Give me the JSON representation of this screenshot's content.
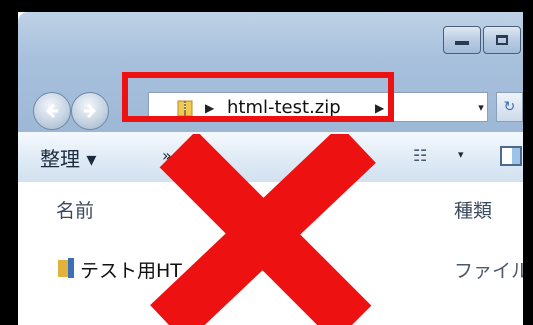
{
  "window": {
    "minimize_icon": "minimize-icon",
    "maximize_icon": "maximize-icon"
  },
  "navigation": {
    "back_icon": "back-arrow-icon",
    "forward_icon": "forward-arrow-icon",
    "address": {
      "path_label": "html-test.zip",
      "icon": "zip-folder-icon",
      "refresh_icon": "refresh-icon"
    }
  },
  "toolbar": {
    "organize_label": "整理 ▾",
    "more_label": "»",
    "view_icon": "view-list-icon",
    "preview_pane_icon": "preview-pane-icon"
  },
  "columns": {
    "name": "名前",
    "type": "種類"
  },
  "files": [
    {
      "name": "テスト用HT",
      "type": "ファイル",
      "icon": "folder-icon"
    }
  ],
  "overlay": {
    "highlight_color": "#ee1111",
    "x_mark_color": "#ee1111",
    "icon": "red-x-mark"
  }
}
